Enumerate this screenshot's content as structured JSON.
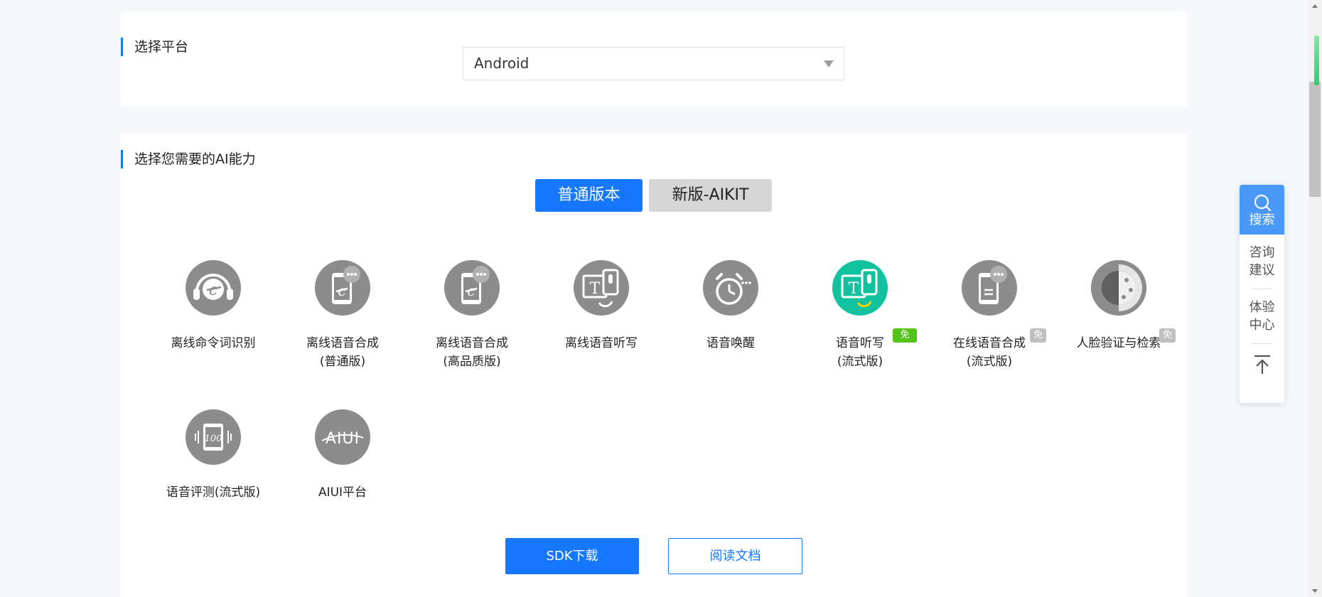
{
  "platform": {
    "title": "选择平台",
    "selected": "Android"
  },
  "ability": {
    "title": "选择您需要的AI能力",
    "tabs": [
      {
        "label": "普通版本",
        "active": true
      },
      {
        "label": "新版-AIKIT",
        "active": false
      }
    ],
    "items": [
      {
        "line1": "离线命令词识别",
        "line2": "",
        "icon": "headset-c-icon",
        "badge": ""
      },
      {
        "line1": "离线语音合成",
        "line2": "(普通版)",
        "icon": "phone-c-chat-icon",
        "badge": ""
      },
      {
        "line1": "离线语音合成",
        "line2": "(高品质版)",
        "icon": "phone-c-chat-icon",
        "badge": ""
      },
      {
        "line1": "离线语音听写",
        "line2": "",
        "icon": "text-mic-icon",
        "badge": ""
      },
      {
        "line1": "语音唤醒",
        "line2": "",
        "icon": "alarm-clock-icon",
        "badge": ""
      },
      {
        "line1": "语音听写",
        "line2": "(流式版)",
        "icon": "text-mic-icon",
        "badge": "免费"
      },
      {
        "line1": "在线语音合成",
        "line2": "(流式版)",
        "icon": "phone-chat-icon",
        "badge": "免费"
      },
      {
        "line1": "人脸验证与检索",
        "line2": "",
        "icon": "face-icon",
        "badge": "免费"
      },
      {
        "line1": "语音评测(流式版)",
        "line2": "",
        "icon": "score-100-icon",
        "badge": ""
      },
      {
        "line1": "AIUI平台",
        "line2": "",
        "icon": "aiui-logo-icon",
        "badge": ""
      }
    ]
  },
  "actions": {
    "sdk_download": "SDK下载",
    "read_docs": "阅读文档"
  },
  "side_toolbar": {
    "search": "搜索",
    "feedback_line1": "咨询",
    "feedback_line2": "建议",
    "experience_line1": "体验",
    "experience_line2": "中心"
  },
  "colors": {
    "primary": "#1677ff",
    "active_icon": "#12c29f",
    "free_badge_green": "#52c41a",
    "free_badge_gray": "#bfbfbf"
  }
}
